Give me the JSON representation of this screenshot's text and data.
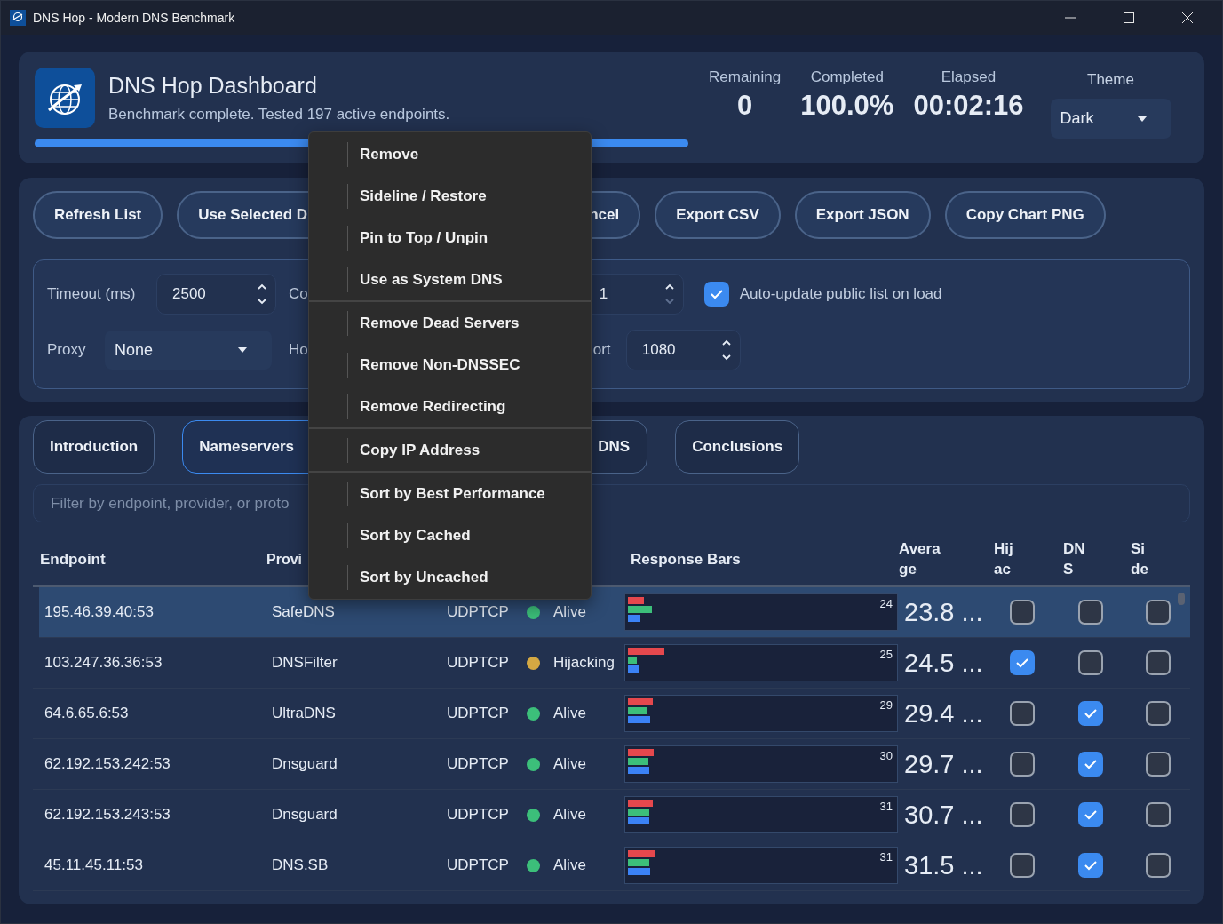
{
  "window": {
    "title": "DNS Hop - Modern DNS Benchmark"
  },
  "header": {
    "title": "DNS Hop Dashboard",
    "subtitle": "Benchmark complete. Tested 197 active endpoints.",
    "progress": {
      "level": 1
    },
    "stats": [
      {
        "label": "Remaining",
        "value": "0"
      },
      {
        "label": "Completed",
        "value": "100.0%"
      },
      {
        "label": "Elapsed",
        "value": "00:02:16"
      }
    ],
    "theme": {
      "label": "Theme",
      "value": "Dark"
    }
  },
  "toolbar": {
    "buttons": [
      "Refresh List",
      "Use Selected D",
      "ncel",
      "Export CSV",
      "Export JSON",
      "Copy Chart PNG"
    ]
  },
  "settings": {
    "timeout": {
      "label": "Timeout (ms)",
      "value": "2500",
      "down_disabled": false
    },
    "concurrency": {
      "label": "Co",
      "value": "1",
      "down_disabled": true
    },
    "auto_update": {
      "label": "Auto-update public list on load",
      "checked": true
    },
    "proxy": {
      "label": "Proxy",
      "value": "None"
    },
    "host": {
      "label": "Ho"
    },
    "port": {
      "label": "ort",
      "value": "1080",
      "down_disabled": false
    }
  },
  "tabs": [
    {
      "label": "Introduction",
      "selected": false
    },
    {
      "label": "Nameservers",
      "selected": true
    },
    {
      "label": "DNS",
      "selected": false
    },
    {
      "label": "Conclusions",
      "selected": false
    }
  ],
  "filter": {
    "placeholder": "Filter by endpoint, provider, or proto"
  },
  "table": {
    "columns": [
      "Endpoint",
      "Provi",
      "Response Bars",
      "Average",
      "Hijac",
      "DNS",
      "Side"
    ],
    "rows": [
      {
        "endpoint": "195.46.39.40:53",
        "provider": "SafeDNS",
        "protocol": "UDPTCP",
        "status": "Alive",
        "color": "#3cbf7a",
        "bars": [
          {
            "level": 0.065
          },
          {
            "level": 0.095
          },
          {
            "level": 0.05
          }
        ],
        "bar_value": "24",
        "average": "23.8 ...",
        "hijack": false,
        "dns": false,
        "side": false,
        "selected": true
      },
      {
        "endpoint": "103.247.36.36:53",
        "provider": "DNSFilter",
        "protocol": "UDPTCP",
        "status": "Hijacking",
        "color": "#d4a843",
        "bars": [
          {
            "level": 0.145
          },
          {
            "level": 0.035
          },
          {
            "level": 0.047
          }
        ],
        "bar_value": "25",
        "average": "24.5 ...",
        "hijack": true,
        "dns": false,
        "side": false,
        "selected": false
      },
      {
        "endpoint": "64.6.65.6:53",
        "provider": "UltraDNS",
        "protocol": "UDPTCP",
        "status": "Alive",
        "color": "#3cbf7a",
        "bars": [
          {
            "level": 0.098
          },
          {
            "level": 0.073
          },
          {
            "level": 0.088
          }
        ],
        "bar_value": "29",
        "average": "29.4 ...",
        "hijack": false,
        "dns": true,
        "side": false,
        "selected": false
      },
      {
        "endpoint": "62.192.153.242:53",
        "provider": "Dnsguard",
        "protocol": "UDPTCP",
        "status": "Alive",
        "color": "#3cbf7a",
        "bars": [
          {
            "level": 0.102
          },
          {
            "level": 0.08
          },
          {
            "level": 0.085
          }
        ],
        "bar_value": "30",
        "average": "29.7 ...",
        "hijack": false,
        "dns": true,
        "side": false,
        "selected": false
      },
      {
        "endpoint": "62.192.153.243:53",
        "provider": "Dnsguard",
        "protocol": "UDPTCP",
        "status": "Alive",
        "color": "#3cbf7a",
        "bars": [
          {
            "level": 0.098
          },
          {
            "level": 0.085
          },
          {
            "level": 0.085
          }
        ],
        "bar_value": "31",
        "average": "30.7 ...",
        "hijack": false,
        "dns": true,
        "side": false,
        "selected": false
      },
      {
        "endpoint": "45.11.45.11:53",
        "provider": "DNS.SB",
        "protocol": "UDPTCP",
        "status": "Alive",
        "color": "#3cbf7a",
        "bars": [
          {
            "level": 0.108
          },
          {
            "level": 0.085
          },
          {
            "level": 0.088
          }
        ],
        "bar_value": "31",
        "average": "31.5 ...",
        "hijack": false,
        "dns": true,
        "side": false,
        "selected": false
      }
    ]
  },
  "context_menu": {
    "groups": [
      [
        "Remove",
        "Sideline / Restore",
        "Pin to Top / Unpin",
        "Use as System DNS"
      ],
      [
        "Remove Dead Servers",
        "Remove Non-DNSSEC",
        "Remove Redirecting"
      ],
      [
        "Copy IP Address"
      ],
      [
        "Sort by Best Performance",
        "Sort by Cached",
        "Sort by Uncached"
      ]
    ]
  }
}
